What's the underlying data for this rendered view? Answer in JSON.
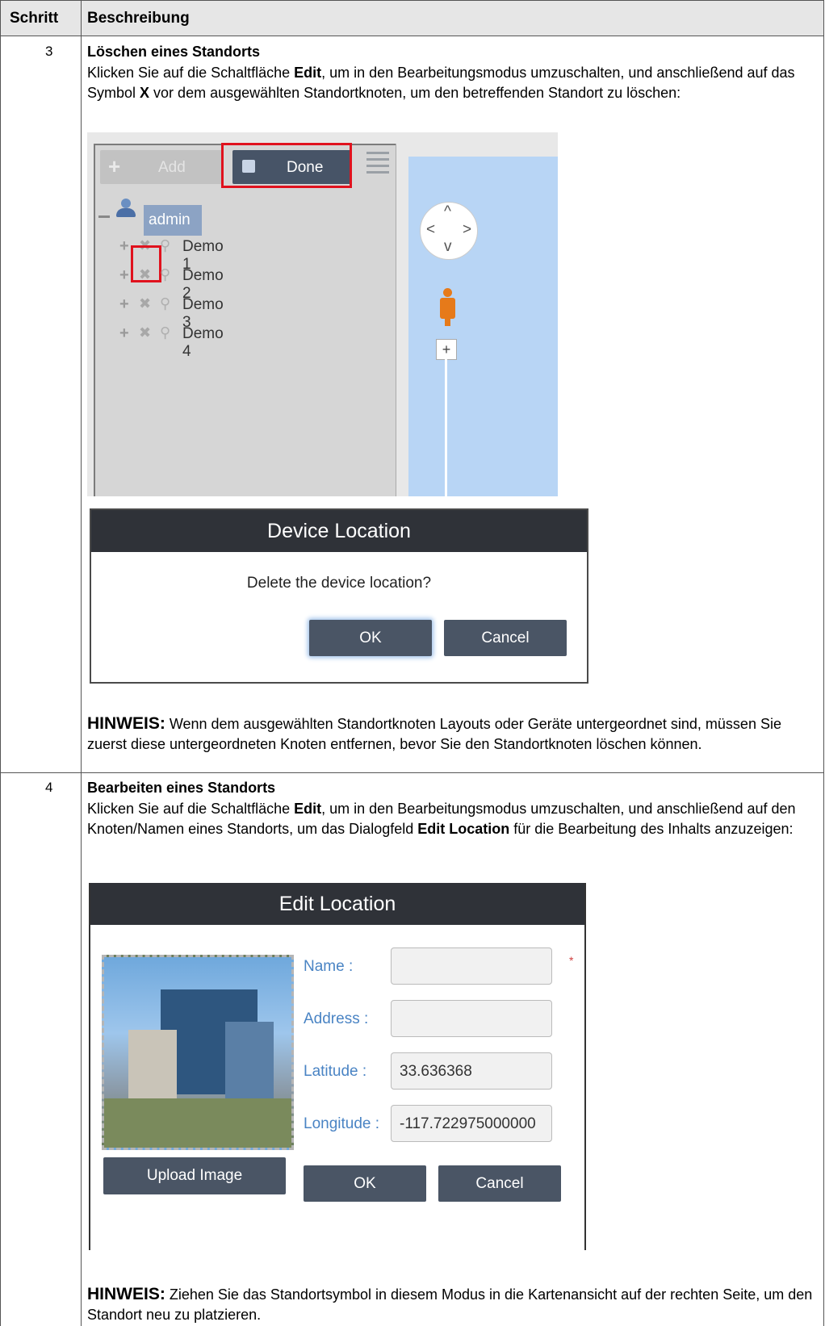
{
  "table": {
    "col_step": "Schritt",
    "col_desc": "Beschreibung"
  },
  "step3": {
    "number": "3",
    "title": "Löschen eines Standorts",
    "p1": "Klicken Sie auf die Schaltfläche ",
    "p1_b1": "Edit",
    "p1_2": ", um in den Bearbeitungsmodus umzuschalten, und anschließend auf das Symbol ",
    "p1_b2": "X",
    "p1_3": " vor dem ausgewählten Standortknoten, um den betreffenden Standort zu löschen:",
    "screenshot": {
      "add_label": "Add",
      "done_label": "Done",
      "root_label": "admin",
      "nodes": [
        "Demo 1",
        "Demo 2",
        "Demo 3",
        "Demo 4"
      ]
    },
    "dialog": {
      "title": "Device Location",
      "message": "Delete the device location?",
      "ok": "OK",
      "cancel": "Cancel"
    },
    "note_label": "HINWEIS:",
    "note_text": " Wenn dem ausgewählten Standortknoten Layouts oder Geräte untergeordnet sind, müssen Sie zuerst diese untergeordneten Knoten entfernen, bevor Sie den Standortknoten löschen können."
  },
  "step4": {
    "number": "4",
    "title": "Bearbeiten eines Standorts",
    "p1": "Klicken Sie auf die Schaltfläche ",
    "p1_b1": "Edit",
    "p1_2": ", um in den Bearbeitungsmodus umzuschalten, und anschließend auf den Knoten/Namen eines Standorts, um das Dialogfeld ",
    "p1_b2": "Edit Location",
    "p1_3": " für die Bearbeitung des Inhalts anzuzeigen:",
    "dialog": {
      "title": "Edit Location",
      "name_label": "Name :",
      "address_label": "Address :",
      "latitude_label": "Latitude :",
      "longitude_label": "Longitude :",
      "name_value": "",
      "address_value": "",
      "latitude_value": "33.636368",
      "longitude_value": "-117.722975000000",
      "required_mark": "*",
      "upload": "Upload Image",
      "ok": "OK",
      "cancel": "Cancel"
    },
    "note_label": "HINWEIS:",
    "note_text": " Ziehen Sie das Standortsymbol in diesem Modus in die Kartenansicht auf der rechten Seite, um den Standort neu zu platzieren."
  }
}
